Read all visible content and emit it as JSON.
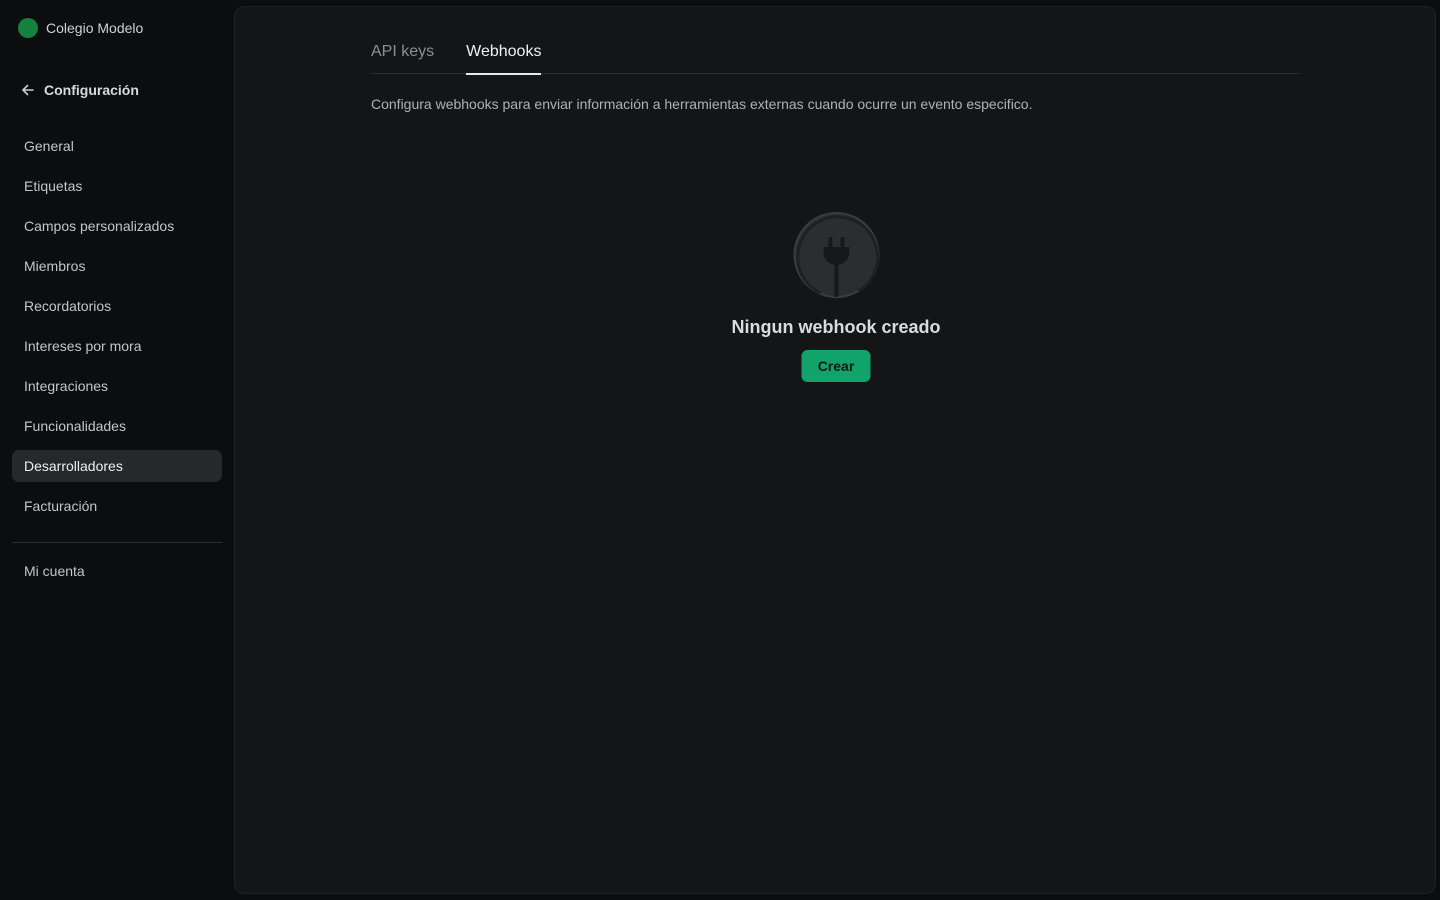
{
  "org": {
    "name": "Colegio Modelo",
    "color": "#14823f"
  },
  "back": {
    "label": "Configuración"
  },
  "sidebar": {
    "items": [
      {
        "label": "General"
      },
      {
        "label": "Etiquetas"
      },
      {
        "label": "Campos personalizados"
      },
      {
        "label": "Miembros"
      },
      {
        "label": "Recordatorios"
      },
      {
        "label": "Intereses por mora"
      },
      {
        "label": "Integraciones"
      },
      {
        "label": "Funcionalidades"
      },
      {
        "label": "Desarrolladores",
        "active": true
      },
      {
        "label": "Facturación"
      }
    ],
    "account": {
      "label": "Mi cuenta"
    }
  },
  "tabs": [
    {
      "label": "API keys"
    },
    {
      "label": "Webhooks",
      "active": true
    }
  ],
  "description": "Configura webhooks para enviar información a herramientas externas cuando ocurre un evento especifico.",
  "empty_state": {
    "icon": "plug-icon",
    "title": "Ningun webhook creado",
    "button_label": "Crear"
  },
  "colors": {
    "accent": "#12a36a",
    "background": "#0c0d0e",
    "panel": "#141517"
  }
}
